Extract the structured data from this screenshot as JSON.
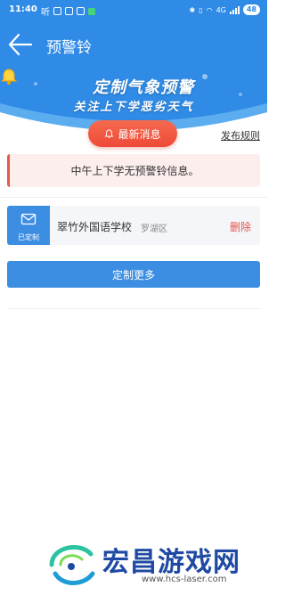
{
  "status_bar": {
    "time": "11:40",
    "carrier": "听",
    "signal_label": "4G",
    "battery": "48"
  },
  "nav": {
    "title": "预警铃",
    "back_icon": "arrow-left-icon"
  },
  "banner": {
    "title": "定制气象预警",
    "subtitle": "关注上下学恶劣天气",
    "icon": "bell-icon",
    "colors": {
      "sky": "#2f8be6",
      "wave": "#7cc4f5",
      "glow": "#ffd23f"
    }
  },
  "news": {
    "badge_label": "最新消息",
    "badge_icon": "bell-icon",
    "rules_link": "发布规则",
    "notice_text": "中午上下学无预警铃信息。",
    "accent": "#e65a4e"
  },
  "subscriptions": [
    {
      "status": "已定制",
      "icon": "envelope-icon",
      "school": "翠竹外国语学校",
      "district": "罗湖区",
      "delete_label": "删除"
    }
  ],
  "more_button": {
    "label": "定制更多",
    "color": "#3c8ee2"
  },
  "watermark": {
    "title": "宏昌游戏网",
    "url": "www.hcs-laser.com"
  }
}
